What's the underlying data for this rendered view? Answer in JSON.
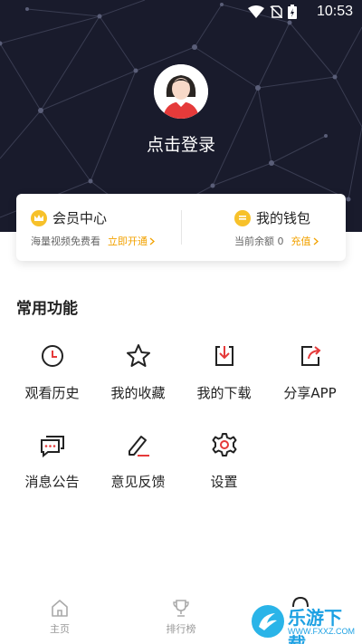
{
  "status_bar": {
    "time": "10:53"
  },
  "profile": {
    "login_text": "点击登录"
  },
  "vip": {
    "title": "会员中心",
    "subtitle": "海量视频免费看",
    "action": "立即开通"
  },
  "wallet": {
    "title": "我的钱包",
    "balance_text": "当前余额 0",
    "action": "充值"
  },
  "section": {
    "title": "常用功能"
  },
  "functions": [
    {
      "label": "观看历史",
      "icon": "clock-icon"
    },
    {
      "label": "我的收藏",
      "icon": "star-icon"
    },
    {
      "label": "我的下载",
      "icon": "download-icon"
    },
    {
      "label": "分享APP",
      "icon": "share-icon"
    },
    {
      "label": "消息公告",
      "icon": "message-icon"
    },
    {
      "label": "意见反馈",
      "icon": "edit-icon"
    },
    {
      "label": "设置",
      "icon": "gear-icon"
    }
  ],
  "bottom_nav": [
    {
      "label": "主页",
      "icon": "home-icon"
    },
    {
      "label": "排行榜",
      "icon": "trophy-icon"
    }
  ],
  "watermark": {
    "text": "乐游下载",
    "url": "WWW.FXXZ.COM"
  },
  "colors": {
    "header_bg": "#191b2c",
    "accent": "#f2a200",
    "coin": "#f7c12a"
  }
}
